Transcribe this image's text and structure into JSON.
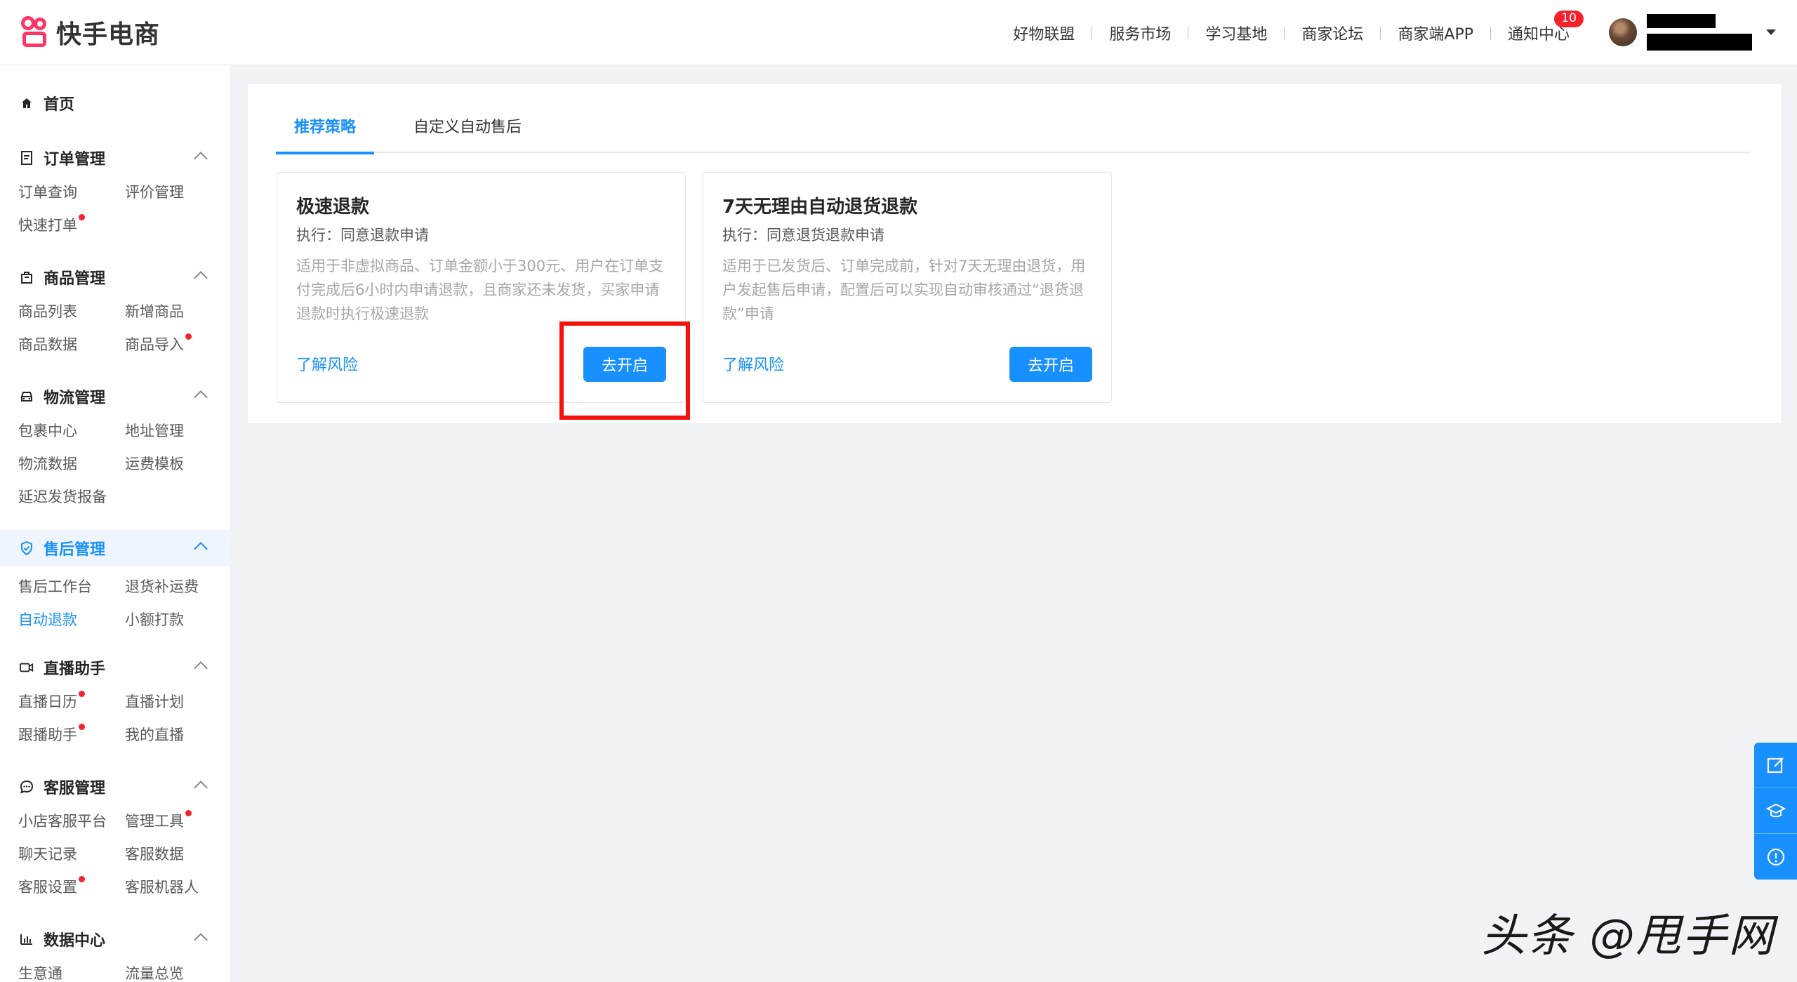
{
  "header": {
    "brand": "快手电商",
    "nav": [
      {
        "label": "好物联盟"
      },
      {
        "label": "服务市场"
      },
      {
        "label": "学习基地"
      },
      {
        "label": "商家论坛"
      },
      {
        "label": "商家端APP"
      },
      {
        "label": "通知中心",
        "badge": "10"
      }
    ]
  },
  "sidebar": {
    "home": "首页",
    "sections": [
      {
        "title": "订单管理",
        "icon": "document-icon",
        "items": [
          {
            "label": "订单查询"
          },
          {
            "label": "评价管理"
          },
          {
            "label": "快速打单",
            "dot": true
          }
        ]
      },
      {
        "title": "商品管理",
        "icon": "bag-icon",
        "items": [
          {
            "label": "商品列表"
          },
          {
            "label": "新增商品"
          },
          {
            "label": "商品数据"
          },
          {
            "label": "商品导入",
            "dot": true
          }
        ]
      },
      {
        "title": "物流管理",
        "icon": "car-icon",
        "items": [
          {
            "label": "包裹中心"
          },
          {
            "label": "地址管理"
          },
          {
            "label": "物流数据"
          },
          {
            "label": "运费模板"
          },
          {
            "label": "延迟发货报备"
          }
        ]
      },
      {
        "title": "售后管理",
        "icon": "shield-icon",
        "active": true,
        "items": [
          {
            "label": "售后工作台"
          },
          {
            "label": "退货补运费"
          },
          {
            "label": "自动退款",
            "active": true
          },
          {
            "label": "小额打款"
          }
        ]
      },
      {
        "title": "直播助手",
        "icon": "video-icon",
        "items": [
          {
            "label": "直播日历",
            "dot": true
          },
          {
            "label": "直播计划"
          },
          {
            "label": "跟播助手",
            "dot": true
          },
          {
            "label": "我的直播"
          }
        ]
      },
      {
        "title": "客服管理",
        "icon": "chat-icon",
        "items": [
          {
            "label": "小店客服平台"
          },
          {
            "label": "管理工具",
            "dot": true
          },
          {
            "label": "聊天记录"
          },
          {
            "label": "客服数据"
          },
          {
            "label": "客服设置",
            "dot": true
          },
          {
            "label": "客服机器人"
          }
        ]
      },
      {
        "title": "数据中心",
        "icon": "bar-chart-icon",
        "items": [
          {
            "label": "生意通"
          },
          {
            "label": "流量总览"
          }
        ]
      }
    ]
  },
  "main": {
    "tabs": [
      {
        "label": "推荐策略",
        "active": true
      },
      {
        "label": "自定义自动售后"
      }
    ],
    "cards": [
      {
        "title": "极速退款",
        "exec": "执行：同意退款申请",
        "desc": "适用于非虚拟商品、订单金额小于300元、用户在订单支付完成后6小时内申请退款，且商家还未发货，买家申请退款时执行极速退款",
        "link": "了解风险",
        "button": "去开启"
      },
      {
        "title": "7天无理由自动退货退款",
        "exec": "执行：同意退货退款申请",
        "desc": "适用于已发货后、订单完成前，针对7天无理由退货，用户发起售后申请，配置后可以实现自动审核通过“退货退款”申请",
        "link": "了解风险",
        "button": "去开启"
      }
    ]
  },
  "float_tools": [
    "edit-icon",
    "graduation-cap-icon",
    "info-icon"
  ],
  "watermark": "头条 @甩手网",
  "colors": {
    "accent": "#1890ff",
    "highlight": "#f5110c",
    "badge": "#f5222d"
  }
}
